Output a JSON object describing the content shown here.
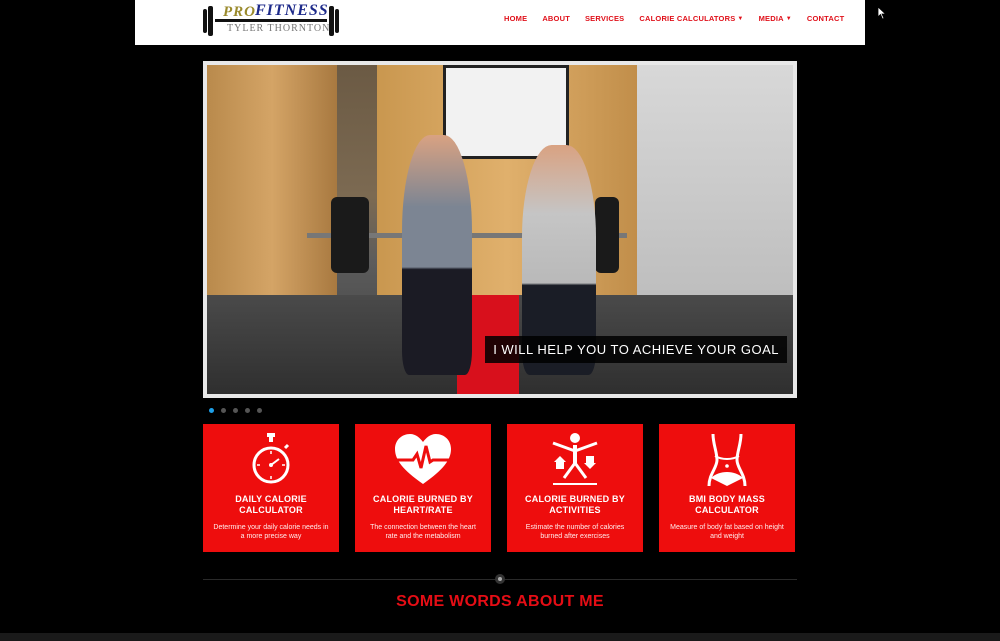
{
  "logo": {
    "line1_pro": "PRO",
    "line1_fitness": "FITNESS",
    "line2": "TYLER THORNTON"
  },
  "nav": {
    "items": [
      {
        "label": "HOME"
      },
      {
        "label": "ABOUT"
      },
      {
        "label": "SERVICES"
      },
      {
        "label": "CALORIE CALCULATORS",
        "dropdown": true
      },
      {
        "label": "MEDIA",
        "dropdown": true
      },
      {
        "label": "CONTACT"
      }
    ]
  },
  "hero": {
    "caption": "I WILL HELP YOU TO ACHIEVE YOUR GOAL",
    "slides_count": 5,
    "active_slide": 1
  },
  "cards": [
    {
      "icon": "stopwatch-icon",
      "title": "DAILY CALORIE CALCULATOR",
      "desc": "Determine your daily calorie needs in a more precise way"
    },
    {
      "icon": "heart-rate-icon",
      "title": "CALORIE BURNED BY HEART/RATE",
      "desc": "The connection between the heart rate and the metabolism"
    },
    {
      "icon": "activity-person-icon",
      "title": "CALORIE BURNED BY ACTIVITIES",
      "desc": "Estimate the number of calories burned after exercises"
    },
    {
      "icon": "body-waist-icon",
      "title": "BMI BODY MASS CALCULATOR",
      "desc": "Measure of body fat based on height and weight"
    }
  ],
  "section": {
    "title": "SOME WORDS ABOUT ME"
  },
  "colors": {
    "accent": "#ee0d0d",
    "nav_text": "#e0101a",
    "dot_active": "#1ea0e8"
  }
}
